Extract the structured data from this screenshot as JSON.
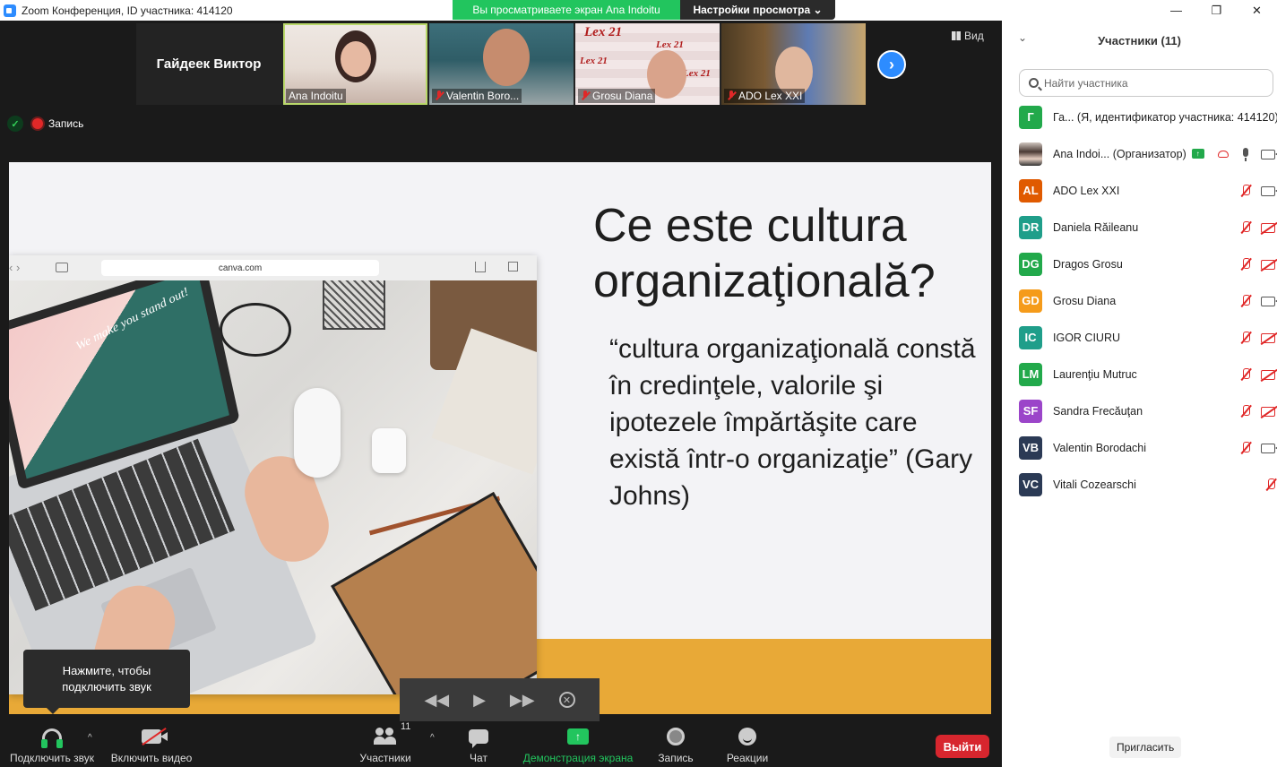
{
  "window": {
    "title": "Zoom Конференция, ID участника: 414120",
    "controls": [
      "—",
      "❐",
      "✕"
    ]
  },
  "share_banner": {
    "viewing": "Вы просматриваете экран Ana Indoitu",
    "view_options": "Настройки просмотра ⌄"
  },
  "strip": {
    "name_tile": "Гайдеек Виктор",
    "tiles": [
      {
        "label": "Ana Indoitu",
        "muted": false
      },
      {
        "label": "Valentin Boro...",
        "muted": true
      },
      {
        "label": "Grosu Diana",
        "muted": true
      },
      {
        "label": "ADO Lex XXI",
        "muted": true
      }
    ],
    "next_icon": "›",
    "view_label": "Вид"
  },
  "status": {
    "recording_label": "Запись",
    "shield_glyph": "✓"
  },
  "slide": {
    "title": "Ce este cultura organizaţională?",
    "quote": "“cultura organizaţională constă în credinţele, valorile şi ipotezele împărtăşite care există într-o organizaţie” (Gary Johns)",
    "browser_url": "canva.com",
    "browser_nav": "‹ ›",
    "laptop_tagline": "We make you stand out!",
    "footer_color": "#e8a937"
  },
  "audio_tooltip": {
    "line1": "Нажмите, чтобы",
    "line2": "подключить звук"
  },
  "playback": {
    "rewind": "◀◀",
    "play": "▶",
    "forward": "▶▶",
    "close": "✕"
  },
  "toolbar": {
    "audio": "Подключить звук",
    "video": "Включить видео",
    "participants": "Участники",
    "participants_count": "11",
    "chat": "Чат",
    "share": "Демонстрация экрана",
    "share_glyph": "↑",
    "record": "Запись",
    "reactions": "Реакции",
    "leave": "Выйти",
    "caret": "^"
  },
  "panel": {
    "title": "Участники (11)",
    "collapse": "⌄",
    "search_placeholder": "Найти участника",
    "host_tag": "↑",
    "invite": "Пригласить",
    "participants": [
      {
        "initials": "Г",
        "name": "Га... (Я, идентификатор участника: 414120)",
        "color": "#22a94b",
        "mic": "none",
        "cam": "none"
      },
      {
        "initials": "",
        "name": "Ana Indoi... (Организатор)",
        "color": "",
        "photo": true,
        "host": true,
        "rec": true,
        "mic": "on",
        "cam": "on"
      },
      {
        "initials": "AL",
        "name": "ADO Lex XXI",
        "color": "#e05a00",
        "mic": "off",
        "cam": "on"
      },
      {
        "initials": "DR",
        "name": "Daniela Răileanu",
        "color": "#1f9e8a",
        "mic": "off",
        "cam": "off"
      },
      {
        "initials": "DG",
        "name": "Dragos Grosu",
        "color": "#22a94b",
        "mic": "off",
        "cam": "off"
      },
      {
        "initials": "GD",
        "name": "Grosu Diana",
        "color": "#f59b1a",
        "mic": "off",
        "cam": "on"
      },
      {
        "initials": "IC",
        "name": "IGOR CIURU",
        "color": "#1f9e8a",
        "mic": "off",
        "cam": "off"
      },
      {
        "initials": "LM",
        "name": "Laurenţiu Mutruc",
        "color": "#22a94b",
        "mic": "off",
        "cam": "off"
      },
      {
        "initials": "SF",
        "name": "Sandra Frecăuţan",
        "color": "#9b45c9",
        "mic": "off",
        "cam": "off"
      },
      {
        "initials": "VB",
        "name": "Valentin Borodachi",
        "color": "#2b3a55",
        "mic": "off",
        "cam": "on"
      },
      {
        "initials": "VC",
        "name": "Vitali Cozearschi",
        "color": "#2b3a55",
        "mic": "off",
        "cam": "none"
      }
    ]
  }
}
